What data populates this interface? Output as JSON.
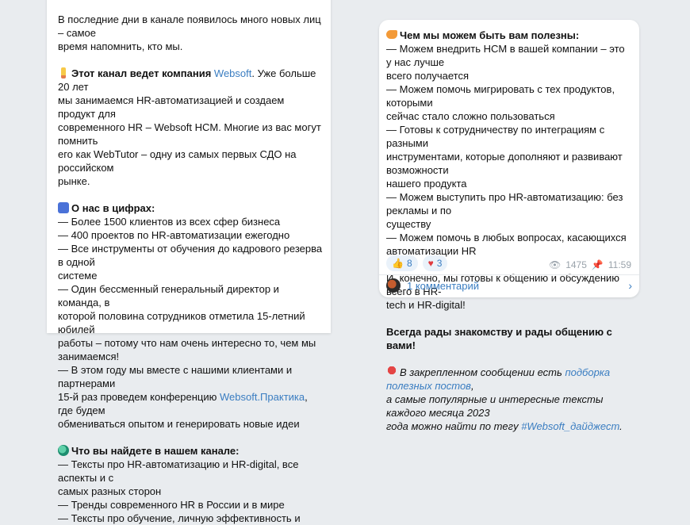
{
  "left": {
    "intro": "В последние дни в канале появилось много новых лиц – самое\nвремя напомнить, кто мы.",
    "about_title": "Этот канал ведет компания ",
    "about_link": "Websoft",
    "about_rest": ". Уже больше 20 лет\nмы занимаемся HR-автоматизацией и создаем продукт для\nсовременного HR – Websoft HCM. Многие из вас могут помнить\nего как WebTutor – одну из самых первых СДО на российском\nрынке.",
    "numbers_title": "О нас в цифрах:",
    "numbers_text": "— Более 1500 клиентов из всех сфер бизнеса\n— 400 проектов по HR-автоматизации ежегодно\n— Все инструменты от обучения до кадрового резерва в одной\nсистеме\n— Один бессменный генеральный директор и команда, в\nкоторой половина сотрудников отметила 15-летний юбилей\nработы – потому что нам очень интересно то, чем мы\nзанимаемся!\n— В этом году мы вместе с нашими клиентами и партнерами\n15-й раз проведем конференцию ",
    "numbers_link": "Websoft.Практика",
    "numbers_rest": ", где будем\nобмениваться опытом и генерировать новые идеи",
    "find_title": "Что вы найдете в нашем канале:",
    "find_text": "— Тексты про HR-автоматизацию и HR-digital, все аспекты и с\nсамых разных сторон\n— Тренды современного HR в России и в мире\n— Тексты про обучение, личную эффективность и"
  },
  "right": {
    "help_title": "Чем мы можем быть вам полезны:",
    "help_text": "— Можем внедрить HCM в вашей компании – это у нас лучше\nвсего получается\n— Можем помочь мигрировать с тех продуктов, которыми\nсейчас стало сложно пользоваться\n— Готовы к сотрудничеству по интеграциям с разными\nинструментами, которые дополняют и развивают возможности\nнашего продукта\n— Можем выступить про HR-автоматизацию: без рекламы и по\nсуществу\n— Можем помочь в любых вопросах, касающихся\nавтоматизации HR",
    "ready_text": "И, конечно, мы готовы к общению и обсуждению всего в HR-\ntech и HR-digital!",
    "welcome": "Всегда рады знакомству и рады общению с вами!",
    "pinned_pre": "В закрепленном сообщении есть ",
    "pinned_link": "подборка полезных постов",
    "pinned_post": ",\nа самые популярные и интересные тексты каждого месяца 2023\nгода можно найти по тегу ",
    "pinned_tag": "#Websoft_дайджест",
    "pinned_end": "."
  },
  "reactions": [
    {
      "emoji": "👍",
      "count": "8"
    },
    {
      "emoji": "♥",
      "count": "3"
    }
  ],
  "views": "1475",
  "time": "11:59",
  "comments_label": "1 комментарий",
  "colors": {
    "link": "#3a7dc1",
    "bg": "#e9ecef"
  }
}
